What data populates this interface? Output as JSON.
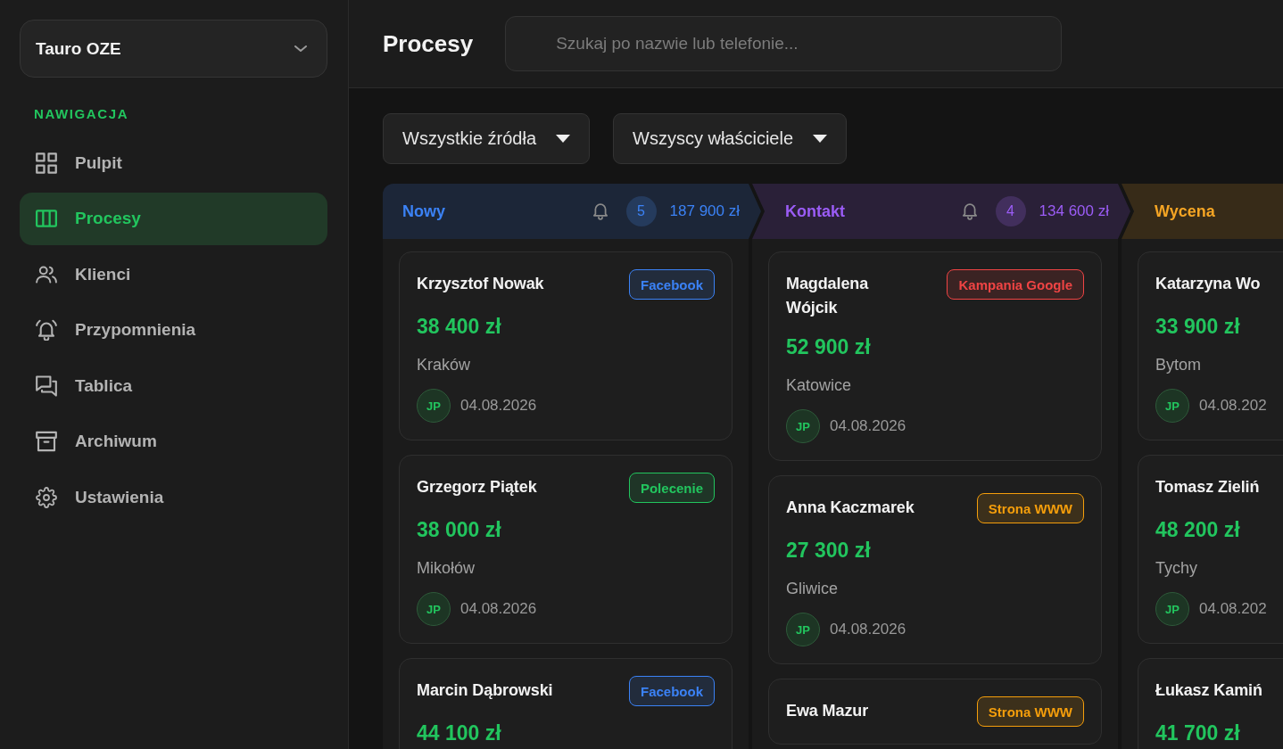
{
  "sidebar": {
    "workspace": "Tauro OZE",
    "section_label": "NAWIGACJA",
    "items": [
      {
        "label": "Pulpit",
        "selected": false
      },
      {
        "label": "Procesy",
        "selected": true
      },
      {
        "label": "Klienci",
        "selected": false
      },
      {
        "label": "Przypomnienia",
        "selected": false
      },
      {
        "label": "Tablica",
        "selected": false
      },
      {
        "label": "Archiwum",
        "selected": false
      },
      {
        "label": "Ustawienia",
        "selected": false
      }
    ]
  },
  "header": {
    "title": "Procesy",
    "search": {
      "placeholder": "Szukaj po nazwie lub telefonie..."
    }
  },
  "filters": [
    {
      "label": "Wszystkie źródła"
    },
    {
      "label": "Wszyscy właściciele"
    }
  ],
  "board": {
    "columns": [
      {
        "title": "Nowy",
        "color": "#3b82f6",
        "count": "5",
        "total": "187 900 zł",
        "cards": [
          {
            "name": "Krzysztof Nowak",
            "tag": {
              "label": "Facebook",
              "color": "#3b82f6"
            },
            "amount": "38 400 zł",
            "city": "Kraków",
            "owner": "JP",
            "date": "04.08.2026"
          },
          {
            "name": "Grzegorz Piątek",
            "tag": {
              "label": "Polecenie",
              "color": "#22c55e"
            },
            "amount": "38 000 zł",
            "city": "Mikołów",
            "owner": "JP",
            "date": "04.08.2026"
          },
          {
            "name": "Marcin Dąbrowski",
            "tag": {
              "label": "Facebook",
              "color": "#3b82f6"
            },
            "amount": "44 100 zł"
          }
        ]
      },
      {
        "title": "Kontakt",
        "color": "#9b5cf6",
        "count": "4",
        "total": "134 600 zł",
        "cards": [
          {
            "name": "Magdalena Wójcik",
            "tag": {
              "label": "Kampania Google",
              "color": "#ef4444"
            },
            "amount": "52 900 zł",
            "city": "Katowice",
            "owner": "JP",
            "date": "04.08.2026"
          },
          {
            "name": "Anna Kaczmarek",
            "tag": {
              "label": "Strona WWW",
              "color": "#f59e0b"
            },
            "amount": "27 300 zł",
            "city": "Gliwice",
            "owner": "JP",
            "date": "04.08.2026"
          },
          {
            "name": "Ewa Mazur",
            "tag": {
              "label": "Strona WWW",
              "color": "#f59e0b"
            }
          }
        ]
      },
      {
        "title": "Wycena",
        "color": "#f5a524",
        "cards": [
          {
            "name": "Katarzyna Wo",
            "amount": "33 900 zł",
            "city": "Bytom",
            "owner": "JP",
            "date": "04.08.202"
          },
          {
            "name": "Tomasz Zieliń",
            "amount": "48 200 zł",
            "city": "Tychy",
            "owner": "JP",
            "date": "04.08.202"
          },
          {
            "name": "Łukasz Kamiń",
            "amount": "41 700 zł"
          }
        ]
      }
    ]
  }
}
